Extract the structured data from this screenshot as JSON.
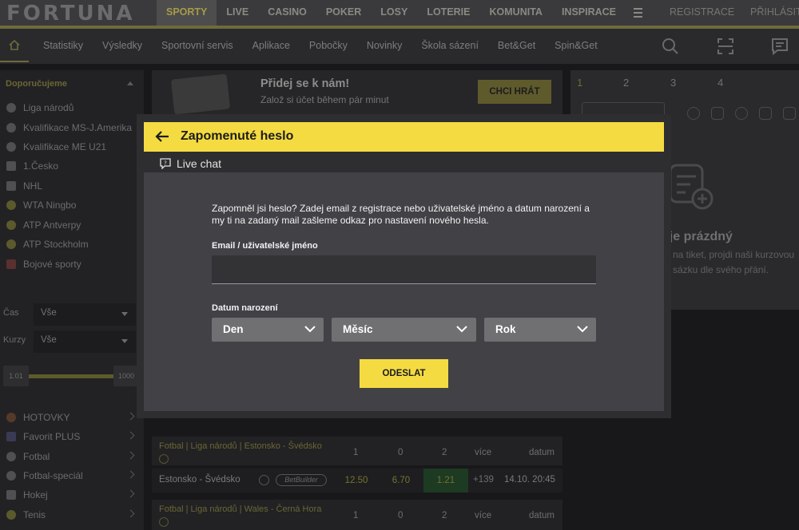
{
  "header": {
    "logo_text": "FORTUNA",
    "nav": [
      {
        "label": "SPORTY"
      },
      {
        "label": "LIVE"
      },
      {
        "label": "CASINO"
      },
      {
        "label": "POKER"
      },
      {
        "label": "LOSY"
      },
      {
        "label": "LOTERIE"
      },
      {
        "label": "KOMUNITA"
      },
      {
        "label": "INSPIRACE"
      }
    ],
    "register_label": "REGISTRACE",
    "login_label": "PŘIHLÁSIT"
  },
  "subnav": {
    "items": [
      {
        "label": "Statistiky"
      },
      {
        "label": "Výsledky"
      },
      {
        "label": "Sportovní servis"
      },
      {
        "label": "Aplikace"
      },
      {
        "label": "Pobočky"
      },
      {
        "label": "Novinky"
      },
      {
        "label": "Škola sázení"
      },
      {
        "label": "Bet&Get"
      },
      {
        "label": "Spin&Get"
      }
    ]
  },
  "sidebar": {
    "heading": "Doporučujeme",
    "items": [
      {
        "label": "Liga národů"
      },
      {
        "label": "Kvalifikace MS-J.Amerika"
      },
      {
        "label": "Kvalifikace ME U21"
      },
      {
        "label": "1.Česko"
      },
      {
        "label": "NHL"
      },
      {
        "label": "WTA Ningbo"
      },
      {
        "label": "ATP Antverpy"
      },
      {
        "label": "ATP Stockholm"
      },
      {
        "label": "Bojové sporty"
      }
    ],
    "time_filter": {
      "label": "Čas",
      "value": "Vše"
    },
    "odds_filter": {
      "label": "Kurzy",
      "value": "Vše"
    },
    "slider": {
      "min_label": "1.01",
      "max_label": "1000"
    },
    "sports": [
      {
        "label": "HOTOVKY"
      },
      {
        "label": "Favorit PLUS"
      },
      {
        "label": "Fotbal"
      },
      {
        "label": "Fotbal-speciál"
      },
      {
        "label": "Hokej"
      },
      {
        "label": "Tenis"
      }
    ]
  },
  "banner": {
    "title": "Přidej se k nám!",
    "subtitle": "Založ si účet během pár minut",
    "cta_label": "CHCI HRÁT"
  },
  "matches": [
    {
      "league": "Fotbal | Liga národů | Estonsko - Švédsko",
      "cols": [
        "1",
        "0",
        "2",
        "více",
        "datum"
      ],
      "name": "Estonsko - Švédsko",
      "badge": "BetBuilder",
      "odds": [
        "12.50",
        "6.70",
        "1.21"
      ],
      "more": "+139",
      "date": "14.10. 20:45"
    },
    {
      "league": "Fotbal | Liga národů | Wales - Černá Hora",
      "cols": [
        "1",
        "0",
        "2",
        "více",
        "datum"
      ]
    }
  ],
  "ticket": {
    "tabs": [
      "1",
      "2",
      "3",
      "4"
    ],
    "empty_title": ": je prázdný",
    "empty_text": "na tiket, projdi naši kurzovou sázku dle svého přání."
  },
  "modal": {
    "title": "Zapomenuté heslo",
    "live_chat_label": "Live chat",
    "description": "Zapomněl jsi heslo? Zadej email z registrace nebo uživatelské jméno a datum narození a my ti na zadaný mail zašleme odkaz pro nastavení nového hesla.",
    "email_label": "Email / uživatelské jméno",
    "email_value": "",
    "dob_label": "Datum narození",
    "day_label": "Den",
    "month_label": "Měsíc",
    "year_label": "Rok",
    "submit_label": "ODESLAT"
  },
  "colors": {
    "accent_yellow": "#f5db42",
    "modal_bg": "#2e2e31",
    "modal_body": "#424246",
    "select_bg": "#707073"
  }
}
